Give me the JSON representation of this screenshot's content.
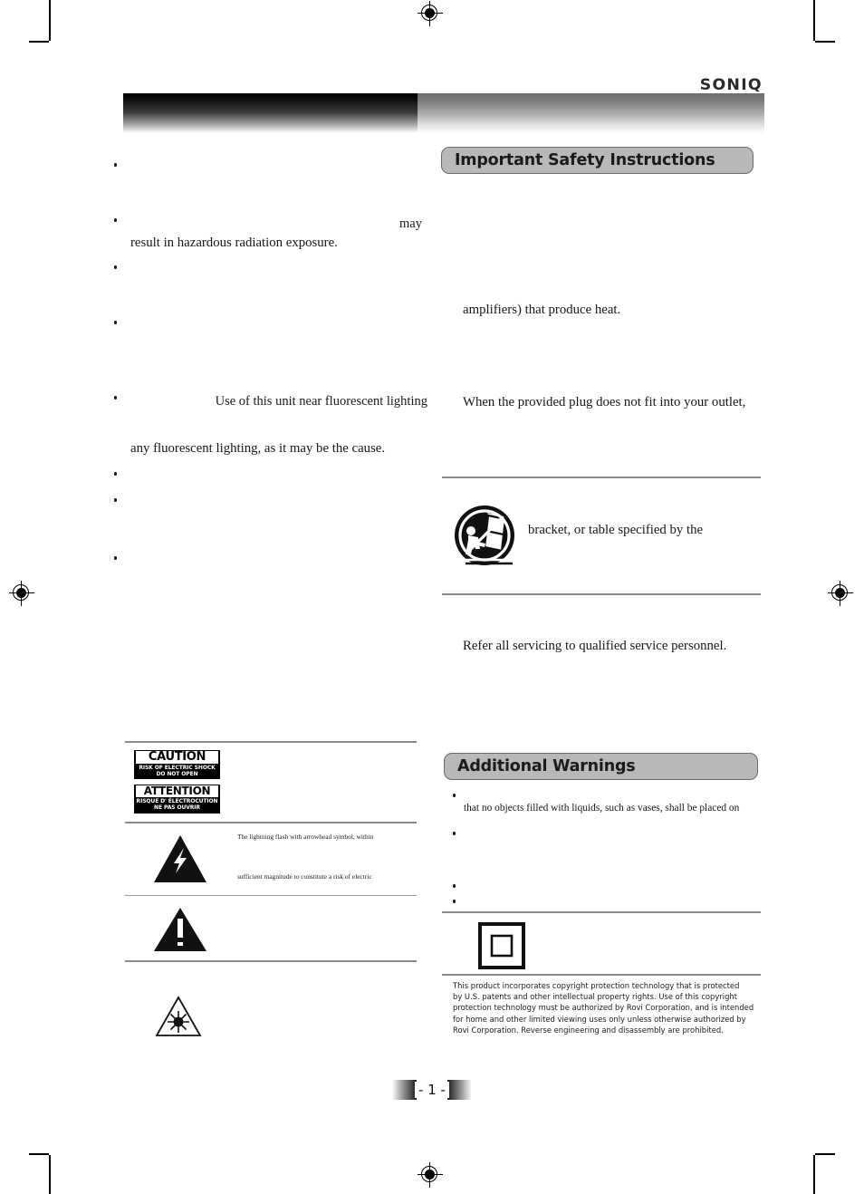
{
  "page": {
    "brand": "SONIQ",
    "page_number": "- 1 -"
  },
  "left_column": {
    "bullets": [
      {
        "visible_text": "",
        "hidden": true
      },
      {
        "visible_text": "may",
        "trailing_line": "result in hazardous radiation exposure.",
        "hidden": true
      },
      {
        "visible_text": "",
        "hidden": true
      },
      {
        "visible_text": "",
        "hidden": true
      },
      {
        "visible_text": "Use of this unit near fluorescent lighting",
        "trailing_line": "any fluorescent lighting, as it may be the cause.",
        "hidden": true
      },
      {
        "visible_text": "",
        "hidden": true
      },
      {
        "visible_text": "",
        "hidden": true
      },
      {
        "visible_text": "",
        "hidden": true
      }
    ],
    "caution_plate": {
      "head": "CAUTION",
      "line1": "RISK OF ELECTRIC SHOCK",
      "line2": "DO NOT OPEN"
    },
    "attention_plate": {
      "head": "ATTENTION",
      "line1": "RISQUE D' ÉLECTROCUTION",
      "line2": "NE PAS OUVRIR"
    },
    "lightning_symbol": {
      "name": "lightning-bolt-triangle-icon",
      "line1": "The lightning flash with arrowhead symbol, within",
      "line2": "sufficient magnitude to constitute a risk of electric"
    },
    "exclamation_symbol": {
      "name": "exclamation-triangle-icon",
      "text": ""
    },
    "laser_symbol": {
      "name": "laser-radiation-triangle-icon",
      "text": ""
    }
  },
  "right_column": {
    "section_title": "Important Safety Instructions",
    "lines": [
      "amplifiers) that produce heat.",
      "When the provided plug does not fit into your outlet,",
      "bracket, or table specified by the",
      "Refer all servicing to qualified service personnel."
    ],
    "cart_symbol": {
      "name": "tipping-cart-warning-icon"
    },
    "additional_warnings": {
      "section_title": "Additional Warnings",
      "bullets": [
        {
          "visible_text": "that no objects filled with liquids, such as vases, shall be placed on"
        },
        {
          "visible_text": ""
        },
        {
          "visible_text": ""
        },
        {
          "visible_text": ""
        }
      ]
    },
    "class2_symbol": {
      "name": "class-ii-double-insulation-icon"
    },
    "copyright_notice": {
      "line1": "This product incorporates copyright protection technology that is protected",
      "line2": "by U.S. patents and other intellectual property rights.  Use of this copyright",
      "line3": "protection technology must be authorized by Rovi Corporation, and is intended",
      "line4": "for home and other limited viewing uses only unless otherwise authorized by",
      "line5": "Rovi Corporation.  Reverse engineering and disassembly are prohibited."
    }
  },
  "colors": {
    "pill_fill": "#b8b8b8",
    "pill_border": "#6b6b6b",
    "rule": "#8a8a8a",
    "text": "#1a1a1a"
  }
}
